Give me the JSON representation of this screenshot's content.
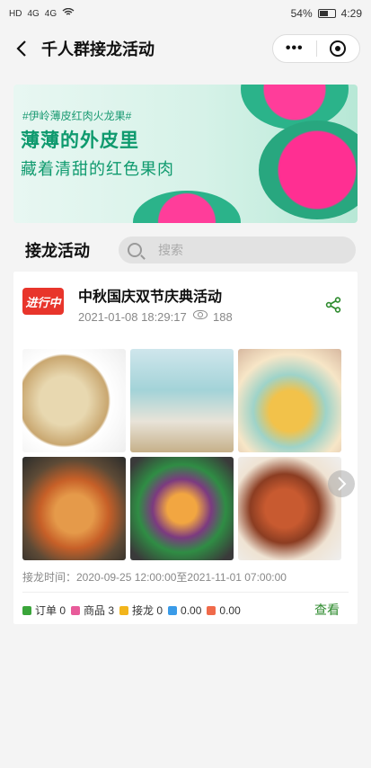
{
  "status_bar": {
    "signal": "HD",
    "network1": "4G",
    "network2": "4G",
    "battery": "54%",
    "time": "4:29"
  },
  "nav": {
    "title": "千人群接龙活动",
    "more": "•••"
  },
  "banner": {
    "tag": "#伊岭薄皮红肉火龙果#",
    "line1": "薄薄的外皮里",
    "line2": "藏着清甜的红色果肉"
  },
  "section": {
    "title": "接龙活动",
    "search_placeholder": "搜索"
  },
  "activity": {
    "status": "进行中",
    "title": "中秋国庆双节庆典活动",
    "created": "2021-01-08 18:29:17",
    "views": "188",
    "period": "接龙时间：2020-09-25 12:00:00至2021-11-01 07:00:00",
    "stats": {
      "orders": "订单 0",
      "products": "商品 3",
      "relays": "接龙 0",
      "amount1": "0.00",
      "amount2": "0.00"
    },
    "view_label": "查看"
  },
  "colors": {
    "accent_green": "#2c8a2c",
    "badge_red": "#e8352b",
    "banner_text": "#0f9a6e"
  }
}
